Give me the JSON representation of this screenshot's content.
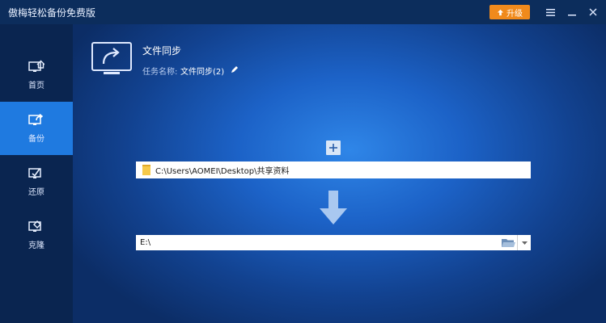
{
  "app": {
    "title": "傲梅轻松备份免费版",
    "upgrade_label": "升级"
  },
  "sidebar": {
    "items": [
      {
        "label": "首页",
        "icon": "home-icon"
      },
      {
        "label": "备份",
        "icon": "backup-icon",
        "active": true
      },
      {
        "label": "还原",
        "icon": "restore-icon"
      },
      {
        "label": "克隆",
        "icon": "clone-icon"
      }
    ]
  },
  "task": {
    "title": "文件同步",
    "name_label": "任务名称:",
    "name_value": "文件同步(2)"
  },
  "source": {
    "path": "C:\\Users\\AOMEI\\Desktop\\共享资料"
  },
  "destination": {
    "path": "E:\\"
  },
  "colors": {
    "accent": "#1f7ae0",
    "upgrade": "#f08a1c",
    "folder": "#f6c94a"
  }
}
